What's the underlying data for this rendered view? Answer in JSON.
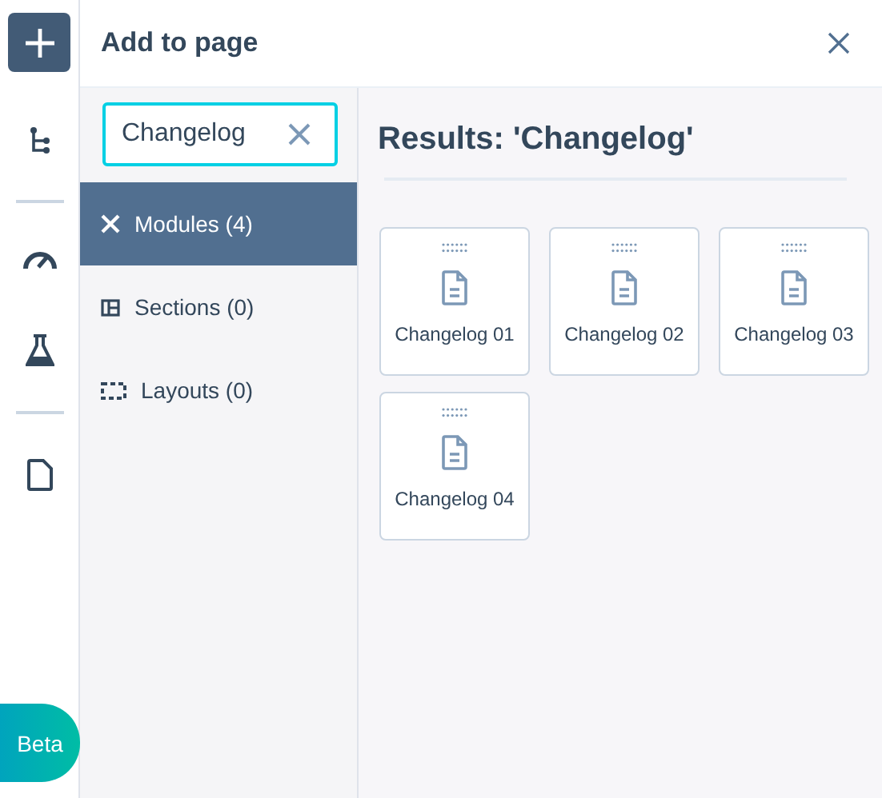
{
  "rail": {
    "badge": "Beta"
  },
  "panel": {
    "title": "Add to page",
    "search": {
      "value": "Changelog"
    },
    "categories": [
      {
        "kind": "modules",
        "label": "Modules (4)",
        "selected": true
      },
      {
        "kind": "sections",
        "label": "Sections (0)",
        "selected": false
      },
      {
        "kind": "layouts",
        "label": "Layouts (0)",
        "selected": false
      }
    ],
    "results_title": "Results: 'Changelog'",
    "results": [
      {
        "label": "Changelog 01"
      },
      {
        "label": "Changelog 02"
      },
      {
        "label": "Changelog 03"
      },
      {
        "label": "Changelog 04"
      }
    ]
  }
}
